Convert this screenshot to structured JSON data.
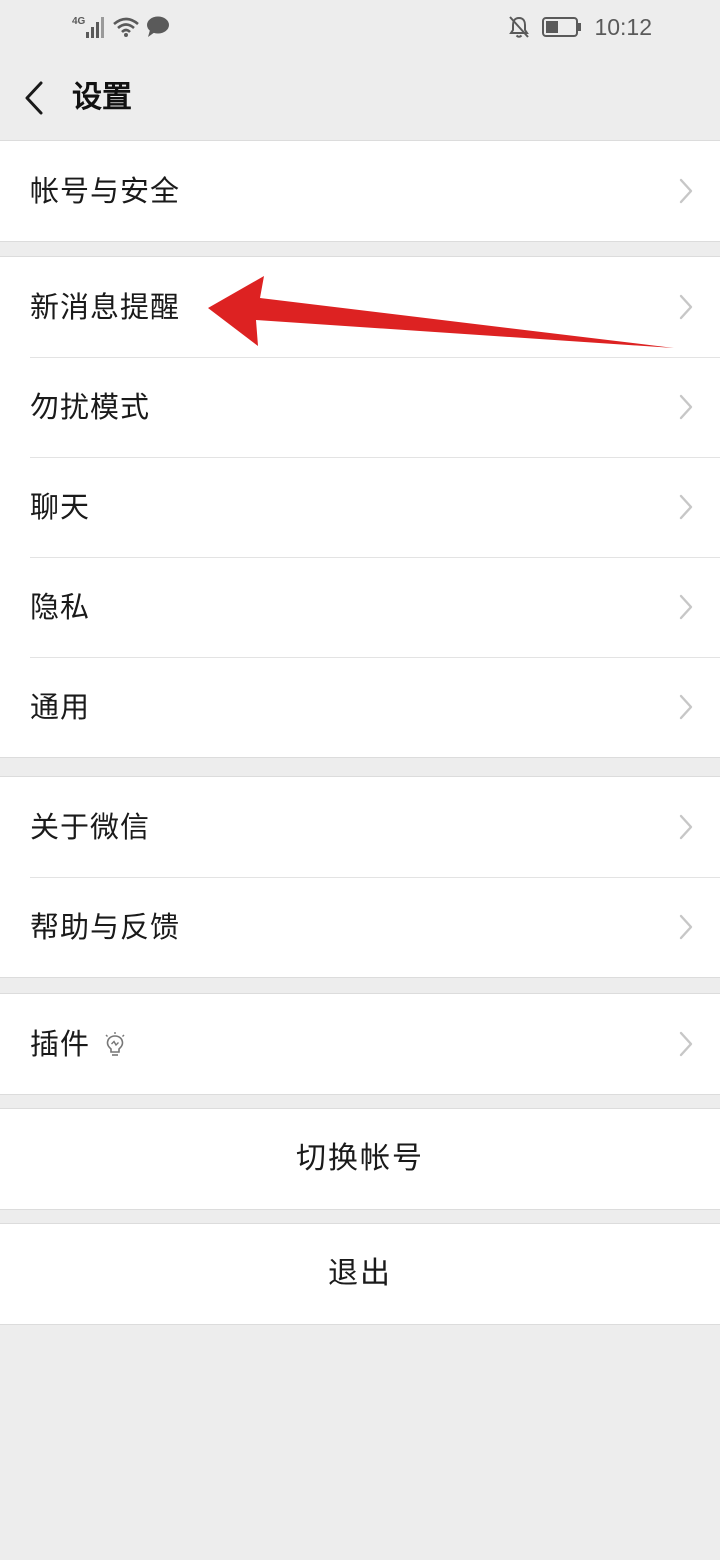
{
  "status_bar": {
    "network": "4G",
    "time": "10:12"
  },
  "nav": {
    "title": "设置"
  },
  "groups": [
    {
      "items": [
        {
          "label": "帐号与安全"
        }
      ]
    },
    {
      "items": [
        {
          "label": "新消息提醒"
        },
        {
          "label": "勿扰模式"
        },
        {
          "label": "聊天"
        },
        {
          "label": "隐私"
        },
        {
          "label": "通用"
        }
      ]
    },
    {
      "items": [
        {
          "label": "关于微信"
        },
        {
          "label": "帮助与反馈"
        }
      ]
    },
    {
      "items": [
        {
          "label": "插件"
        }
      ]
    }
  ],
  "actions": {
    "switch_account": "切换帐号",
    "logout": "退出"
  },
  "colors": {
    "background": "#ededed",
    "cell": "#ffffff",
    "arrow": "#dd2222",
    "chevron": "#c7c7c7"
  },
  "icons": {
    "back": "chevron-left-icon",
    "row_arrow": "chevron-right-icon",
    "plugin": "lightbulb-icon"
  }
}
